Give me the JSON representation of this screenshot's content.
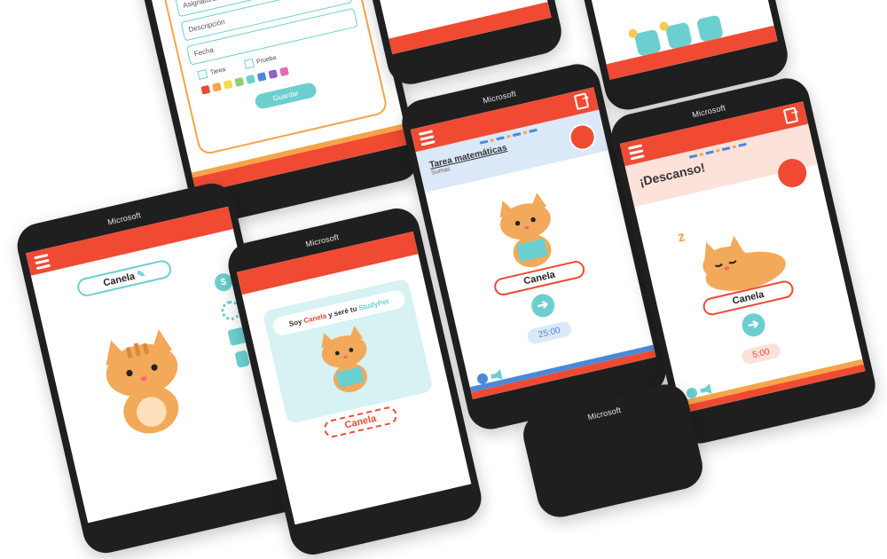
{
  "brand": "Microsoft",
  "form": {
    "subject_placeholder": "Asignatura",
    "description_placeholder": "Descripción",
    "date_placeholder": "Fecha",
    "task_label": "Tarea",
    "exam_label": "Prueba",
    "save_label": "Guardar",
    "swatches": [
      "#f04a33",
      "#f5a44a",
      "#f7d94c",
      "#8bd16c",
      "#6ccfcf",
      "#4a89d8",
      "#8a62c9",
      "#e46ab0"
    ]
  },
  "home": {
    "pet_name": "Canela"
  },
  "intro": {
    "text_prefix": "Soy ",
    "text_name": "Canela",
    "text_middle": " y seré tu ",
    "text_app": "StudyPet",
    "pet_name": "Canela"
  },
  "study": {
    "task_title": "Tarea matemáticas",
    "task_subtitle": "Sumas",
    "pet_name": "Canela",
    "timer": "25:00"
  },
  "rest": {
    "title": "¡Descanso!",
    "pet_name": "Canela",
    "sleep": "z",
    "timer": "5:00"
  },
  "colors": {
    "accent": "#f04a33",
    "teal": "#6ccfcf",
    "cat": "#f2a95a",
    "blue": "#4a89d8"
  }
}
